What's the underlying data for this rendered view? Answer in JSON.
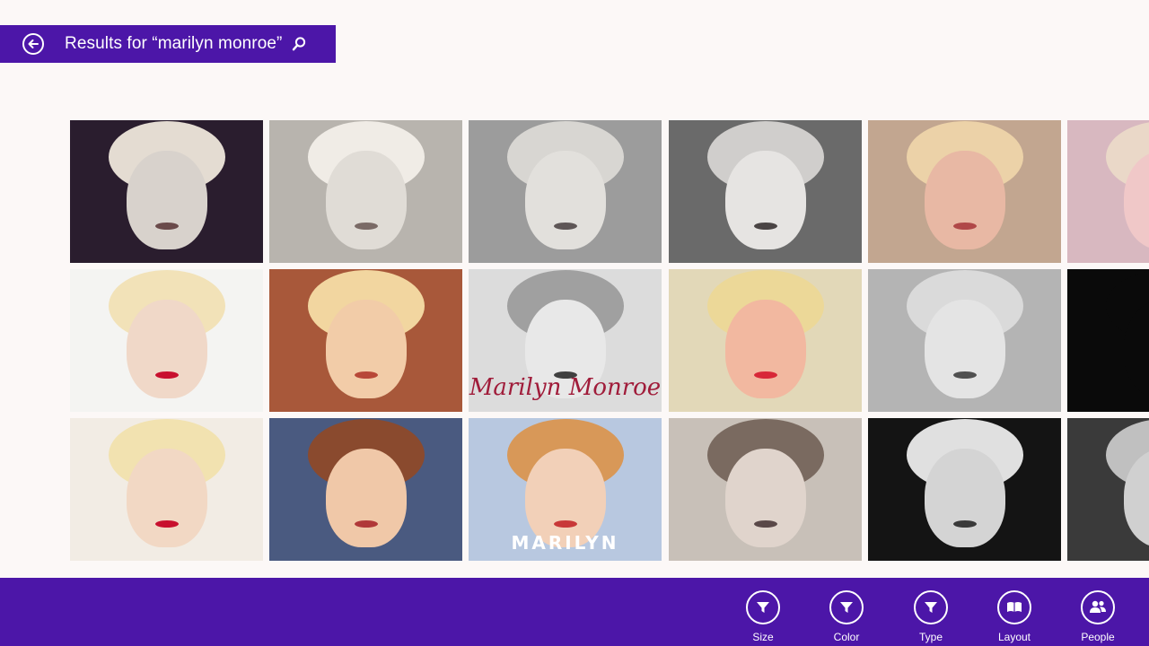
{
  "search": {
    "query_text": "Results for “marilyn monroe”",
    "back_icon": "back-arrow-icon",
    "search_icon": "search-icon"
  },
  "grid": {
    "rows": [
      [
        {
          "bg": "#2a1d2e",
          "hair": "#e4dcd2",
          "face": "#d8d2cc",
          "lips": "#6a4a4a"
        },
        {
          "bg": "#b8b4ae",
          "hair": "#f0ece6",
          "face": "#e0dcd6",
          "lips": "#7a6a66"
        },
        {
          "bg": "#9c9c9c",
          "hair": "#d8d6d2",
          "face": "#e2e0dc",
          "lips": "#5e5656"
        },
        {
          "bg": "#6a6a6a",
          "hair": "#d0cecc",
          "face": "#e6e4e2",
          "lips": "#4a4444"
        },
        {
          "bg": "#c2a690",
          "hair": "#ecd2a8",
          "face": "#e8b8a4",
          "lips": "#b04848"
        },
        {
          "bg": "#d8b8c0",
          "hair": "#ead8c8",
          "face": "#f0c8c8",
          "lips": "#b03040"
        }
      ],
      [
        {
          "bg": "#f4f4f2",
          "hair": "#f2e2b8",
          "face": "#f0d8c8",
          "lips": "#c8102e"
        },
        {
          "bg": "#a8583a",
          "hair": "#f2d6a0",
          "face": "#f2cca8",
          "lips": "#b84838"
        },
        {
          "bg": "#dcdcdc",
          "hair": "#a0a0a0",
          "face": "#e8e8e8",
          "lips": "#404040",
          "script": "Marilyn Monroe"
        },
        {
          "bg": "#e2d8b8",
          "hair": "#ecd898",
          "face": "#f2b8a0",
          "lips": "#d82838"
        },
        {
          "bg": "#b4b4b4",
          "hair": "#dadada",
          "face": "#e4e4e4",
          "lips": "#505050"
        },
        {
          "bg": "#0a0a0a",
          "hair": "#0a0a0a",
          "face": "#0a0a0a",
          "lips": "#0a0a0a"
        }
      ],
      [
        {
          "bg": "#f2ece4",
          "hair": "#f2e2b0",
          "face": "#f2d8c4",
          "lips": "#c8102e"
        },
        {
          "bg": "#4a5a80",
          "hair": "#8a4a2e",
          "face": "#f0c8a8",
          "lips": "#b03838"
        },
        {
          "bg": "#b8c8e0",
          "hair": "#d89858",
          "face": "#f2d0b8",
          "lips": "#c83838",
          "caption": "MARILYN"
        },
        {
          "bg": "#c8c0b8",
          "hair": "#7a6a60",
          "face": "#e0d4cc",
          "lips": "#5a4848"
        },
        {
          "bg": "#141414",
          "hair": "#e0e0e0",
          "face": "#d4d4d4",
          "lips": "#3a3a3a"
        },
        {
          "bg": "#3a3a3a",
          "hair": "#c0c0c0",
          "face": "#d0d0d0",
          "lips": "#3a3a3a"
        }
      ]
    ]
  },
  "app_bar": {
    "buttons": [
      {
        "label": "Size",
        "icon": "filter-icon"
      },
      {
        "label": "Color",
        "icon": "filter-icon"
      },
      {
        "label": "Type",
        "icon": "filter-icon"
      },
      {
        "label": "Layout",
        "icon": "layout-icon"
      },
      {
        "label": "People",
        "icon": "people-icon"
      }
    ]
  },
  "colors": {
    "accent": "#4c16a8",
    "background": "#fcf8f7"
  }
}
